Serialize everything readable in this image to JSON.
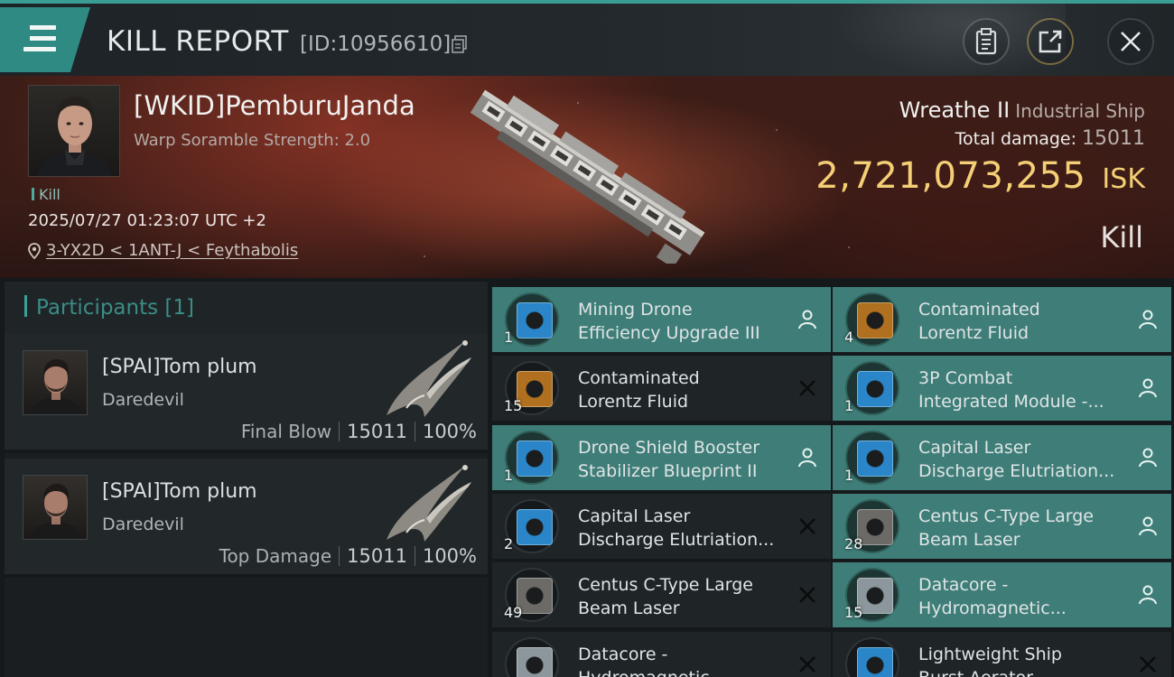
{
  "header": {
    "title": "KILL REPORT",
    "report_id": "[ID:10956610]",
    "menu_icon": "hamburger-menu-icon",
    "buttons": [
      "clipboard-icon",
      "share-icon",
      "close-icon"
    ]
  },
  "victim": {
    "name": "[WKID]PemburuJanda",
    "warp_scramble": "Warp Soramble Strength: 2.0",
    "kill_tag": "Kill",
    "datetime": "2025/07/27 01:23:07 UTC +2",
    "location": "3-YX2D < 1ANT-J < Feythabolis",
    "ship_name": "Wreathe II",
    "ship_class": "Industrial Ship",
    "total_damage_label": "Total damage:",
    "total_damage": "15011",
    "isk_value": "2,721,073,255",
    "isk_unit": "ISK",
    "result": "Kill"
  },
  "participants": {
    "title": "Participants [1]",
    "rows": [
      {
        "name": "[SPAI]Tom plum",
        "ship": "Daredevil",
        "role": "Final Blow",
        "damage": "15011",
        "percent": "100%"
      },
      {
        "name": "[SPAI]Tom plum",
        "ship": "Daredevil",
        "role": "Top Damage",
        "damage": "15011",
        "percent": "100%"
      }
    ]
  },
  "items": [
    {
      "line1": "Mining Drone",
      "line2": "Efficiency Upgrade III",
      "qty": "1",
      "status": "dropped",
      "icon": "drone-upgrade-icon",
      "color": "#2a86c8"
    },
    {
      "line1": "Contaminated",
      "line2": "Lorentz Fluid",
      "qty": "4",
      "status": "dropped",
      "icon": "fluid-canister-icon",
      "color": "#b0701f"
    },
    {
      "line1": "Contaminated",
      "line2": "Lorentz Fluid",
      "qty": "15",
      "status": "destroyed",
      "icon": "fluid-canister-icon",
      "color": "#b0701f"
    },
    {
      "line1": "3P Combat",
      "line2": "Integrated Module -...",
      "qty": "1",
      "status": "dropped",
      "icon": "combat-module-icon",
      "color": "#2a86c8"
    },
    {
      "line1": "Drone Shield Booster",
      "line2": "Stabilizer Blueprint II",
      "qty": "1",
      "status": "dropped",
      "icon": "blueprint-icon",
      "color": "#2a86c8"
    },
    {
      "line1": "Capital Laser",
      "line2": "Discharge Elutriation...",
      "qty": "1",
      "status": "dropped",
      "icon": "laser-rig-icon",
      "color": "#2a86c8"
    },
    {
      "line1": "Capital Laser",
      "line2": "Discharge Elutriation...",
      "qty": "2",
      "status": "destroyed",
      "icon": "laser-rig-icon",
      "color": "#2a86c8"
    },
    {
      "line1": "Centus C-Type Large",
      "line2": "Beam Laser",
      "qty": "28",
      "status": "dropped",
      "icon": "beam-laser-icon",
      "color": "#6b6a66"
    },
    {
      "line1": "Centus C-Type Large",
      "line2": "Beam Laser",
      "qty": "49",
      "status": "destroyed",
      "icon": "beam-laser-icon",
      "color": "#6b6a66"
    },
    {
      "line1": "Datacore -",
      "line2": "Hydromagnetic...",
      "qty": "15",
      "status": "dropped",
      "icon": "datacore-icon",
      "color": "#8b979c"
    },
    {
      "line1": "Datacore -",
      "line2": "Hydromagnetic...",
      "qty": "",
      "status": "destroyed",
      "icon": "datacore-icon",
      "color": "#8b979c"
    },
    {
      "line1": "Lightweight Ship",
      "line2": "Burst Aerator...",
      "qty": "",
      "status": "destroyed",
      "icon": "burst-aerator-icon",
      "color": "#2a86c8"
    }
  ],
  "colors": {
    "accent": "#3a9d93",
    "dropped_bg": "#3f7e78",
    "destroyed_bg": "#1f2427",
    "isk_gold": "#f4cf76"
  }
}
